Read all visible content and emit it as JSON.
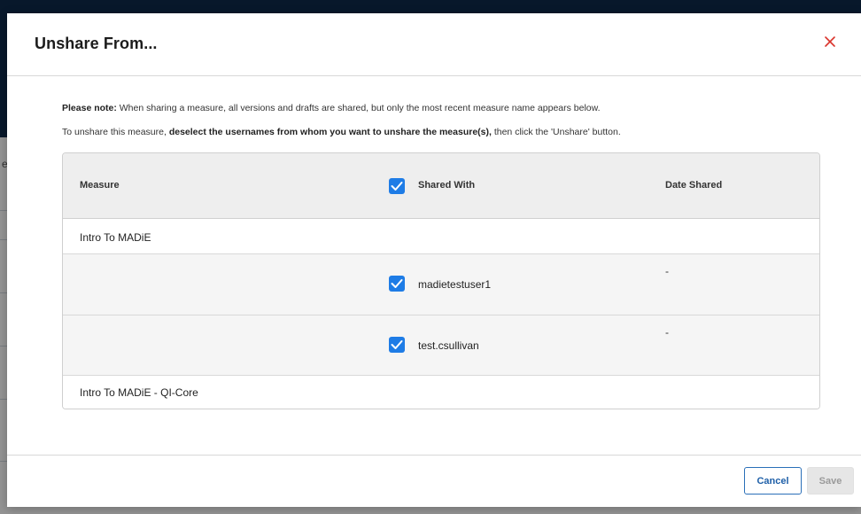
{
  "background": {
    "partial_text": "ea"
  },
  "modal": {
    "title": "Unshare From...",
    "note_1_bold": "Please note:",
    "note_1_rest": " When sharing a measure, all versions and drafts are shared, but only the most recent measure name appears below.",
    "note_2_start": "To unshare this measure, ",
    "note_2_bold": "deselect the usernames from whom you want to unshare the measure(s),",
    "note_2_end": " then click the 'Unshare' button."
  },
  "table": {
    "headers": {
      "measure": "Measure",
      "shared_with": "Shared With",
      "date_shared": "Date Shared"
    },
    "select_all_checked": true,
    "rows": [
      {
        "type": "measure",
        "name": "Intro To MADiE"
      },
      {
        "type": "user",
        "username": "madietestuser1",
        "checked": true,
        "date_shared": "-"
      },
      {
        "type": "user",
        "username": "test.csullivan",
        "checked": true,
        "date_shared": "-"
      },
      {
        "type": "measure",
        "name": "Intro To MADiE - QI-Core"
      }
    ]
  },
  "footer": {
    "cancel_label": "Cancel",
    "save_label": "Save"
  },
  "colors": {
    "accent": "#1e7ce6",
    "header_bg": "#0e2a4a",
    "close_icon": "#d9332b"
  },
  "icons": {
    "close": "close-icon",
    "checkbox": "checkmark-icon"
  }
}
